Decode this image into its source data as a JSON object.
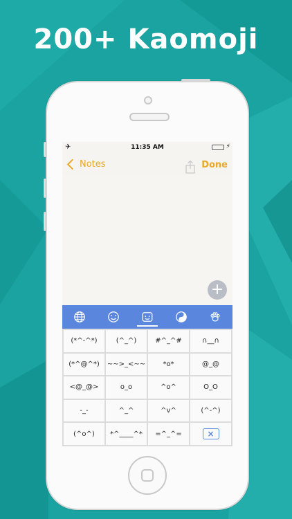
{
  "headline": "200+ Kaomoji",
  "colors": {
    "background": "#1aa3a0",
    "accent": "#e9a827",
    "keyboard_bar": "#5b86dd"
  },
  "status_bar": {
    "time": "11:35 AM",
    "airplane_icon": "airplane-icon",
    "battery_icon": "battery-icon"
  },
  "nav": {
    "back_label": "Notes",
    "done_label": "Done",
    "share_icon": "share-icon"
  },
  "plus_label": "+",
  "keyboard_tabs": [
    {
      "icon": "globe-icon",
      "active": false
    },
    {
      "icon": "smiley-icon",
      "active": false
    },
    {
      "icon": "kaomoji-face-icon",
      "active": true
    },
    {
      "icon": "yin-yang-icon",
      "active": false
    },
    {
      "icon": "paw-icon",
      "active": false
    }
  ],
  "kaomoji_keys": [
    "(*^-^*)",
    "(^_^)",
    "#^_^#",
    "∩__∩",
    "(*^@^*)",
    "~~>_<~~",
    "*o*",
    "@_@",
    "<@_@>",
    "o_o",
    "^o^",
    "O_O",
    "-_-",
    "^_^",
    "^v^",
    "(^-^)",
    "(^o^)",
    "*^____^*",
    "=^_^="
  ],
  "delete_key": {
    "icon": "backspace-icon",
    "glyph": "×"
  }
}
